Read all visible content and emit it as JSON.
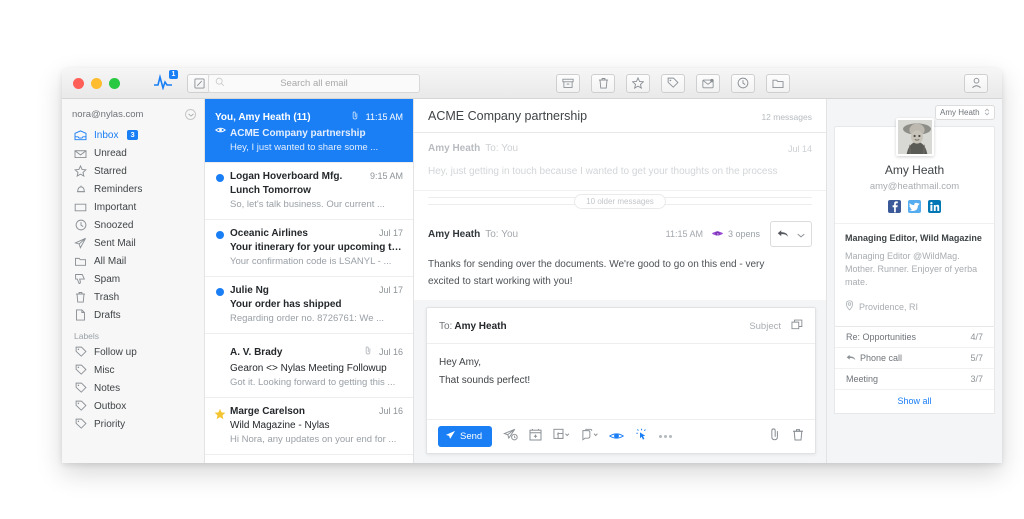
{
  "titlebar": {
    "activity_badge": "1",
    "compose_icon": "compose-icon",
    "search_placeholder": "Search all email",
    "tools": [
      {
        "name": "archive-icon",
        "label": "Archive"
      },
      {
        "name": "trash-icon",
        "label": "Trash"
      },
      {
        "name": "star-icon",
        "label": "Star"
      },
      {
        "name": "tag-icon",
        "label": "Tag"
      },
      {
        "name": "mark-unread-icon",
        "label": "Mark unread"
      },
      {
        "name": "snooze-icon",
        "label": "Snooze"
      },
      {
        "name": "move-folder-icon",
        "label": "Move to folder"
      }
    ],
    "contact_tool": "contact-icon"
  },
  "sidebar": {
    "account": "nora@nylas.com",
    "items": [
      {
        "label": "Inbox",
        "icon": "inbox-icon",
        "count": "3",
        "active": true
      },
      {
        "label": "Unread",
        "icon": "unread-envelope-icon"
      },
      {
        "label": "Starred",
        "icon": "star-icon"
      },
      {
        "label": "Reminders",
        "icon": "bell-icon"
      },
      {
        "label": "Important",
        "icon": "important-tag-icon"
      },
      {
        "label": "Snoozed",
        "icon": "clock-icon"
      },
      {
        "label": "Sent Mail",
        "icon": "paper-plane-icon"
      },
      {
        "label": "All Mail",
        "icon": "folder-icon"
      },
      {
        "label": "Spam",
        "icon": "thumbs-down-icon"
      },
      {
        "label": "Trash",
        "icon": "trash-icon"
      },
      {
        "label": "Drafts",
        "icon": "document-icon"
      }
    ],
    "labels_title": "Labels",
    "labels": [
      {
        "label": "Follow up",
        "icon": "tag-icon"
      },
      {
        "label": "Misc",
        "icon": "tag-icon"
      },
      {
        "label": "Notes",
        "icon": "tag-icon"
      },
      {
        "label": "Outbox",
        "icon": "tag-icon"
      },
      {
        "label": "Priority",
        "icon": "tag-icon"
      }
    ]
  },
  "message_list": [
    {
      "sender": "You, Amy Heath (11)",
      "time": "11:15 AM",
      "subject": "ACME Company partnership",
      "snippet": "Hey, I just wanted to share some ...",
      "selected": true,
      "attachment": true,
      "marker": "eye"
    },
    {
      "sender": "Logan Hoverboard Mfg.",
      "time": "9:15 AM",
      "subject": "Lunch Tomorrow",
      "snippet": "So, let's talk business. Our current ...",
      "marker": "unread"
    },
    {
      "sender": "Oceanic Airlines",
      "time": "Jul 17",
      "subject": "Your itinerary for your upcoming trip",
      "snippet": "Your confirmation code is LSANYL - ...",
      "marker": "unread"
    },
    {
      "sender": "Julie Ng",
      "time": "Jul 17",
      "subject": "Your order has shipped",
      "snippet": "Regarding order no. 8726761: We ...",
      "marker": "unread"
    },
    {
      "sender": "A. V. Brady",
      "time": "Jul 16",
      "subject": "Gearon <> Nylas Meeting Followup",
      "snippet": "Got it. Looking forward to getting this ...",
      "attachment": true,
      "marker": "none"
    },
    {
      "sender": "Marge Carelson",
      "time": "Jul 16",
      "subject": "Wild Magazine - Nylas",
      "snippet": "Hi Nora, any updates on your end for ...",
      "marker": "star"
    }
  ],
  "thread": {
    "title": "ACME Company partnership",
    "count": "12 messages",
    "old_message": {
      "from": "Amy Heath",
      "to": "To: You",
      "date": "Jul 14",
      "body": "Hey, just getting in touch because I wanted to get your thoughts on the process"
    },
    "collapsed_label": "10 older messages",
    "latest_message": {
      "from": "Amy Heath",
      "to": "To: You",
      "time": "11:15 AM",
      "opens": "3 opens",
      "opens_icon": "open-tracking-eye-icon",
      "reply_icon": "reply-arrow-icon",
      "body_line1": "Thanks for sending over the documents. We're good to go on this end - very",
      "body_line2": "excited to start working with you!"
    }
  },
  "compose": {
    "to_label": "To:",
    "to_value": "Amy Heath",
    "subject_placeholder": "Subject",
    "popout_icon": "popout-icon",
    "body_line1": "Hey Amy,",
    "body_line2": "That sounds perfect!",
    "send_label": "Send",
    "tools": [
      {
        "name": "send-later-icon"
      },
      {
        "name": "calendar-insert-icon"
      },
      {
        "name": "template-icon"
      },
      {
        "name": "snippet-icon"
      },
      {
        "name": "open-tracking-icon"
      },
      {
        "name": "link-tracking-icon"
      },
      {
        "name": "more-options-icon"
      }
    ],
    "attach_icon": "paperclip-icon",
    "discard_icon": "trash-icon"
  },
  "contact": {
    "selector": "Amy Heath",
    "name": "Amy Heath",
    "email": "amy@heathmail.com",
    "socials": [
      "facebook-icon",
      "twitter-icon",
      "linkedin-icon"
    ],
    "role": "Managing Editor, Wild Magazine",
    "bio_line1": "Managing Editor @WildMag.",
    "bio_line2": "Mother. Runner. Enjoyer of yerba mate.",
    "location": "Providence, RI",
    "stats": [
      {
        "label": "Re: Opportunities",
        "value": "4/7",
        "icon": "none"
      },
      {
        "label": "Phone call",
        "value": "5/7",
        "icon": "reply-arrow-icon"
      },
      {
        "label": "Meeting",
        "value": "3/7",
        "icon": "none"
      }
    ],
    "show_all": "Show all"
  },
  "colors": {
    "accent": "#1a7ef5",
    "facebook": "#3b5998",
    "twitter": "#55acee",
    "linkedin": "#0077b5",
    "star": "#f5c531"
  }
}
